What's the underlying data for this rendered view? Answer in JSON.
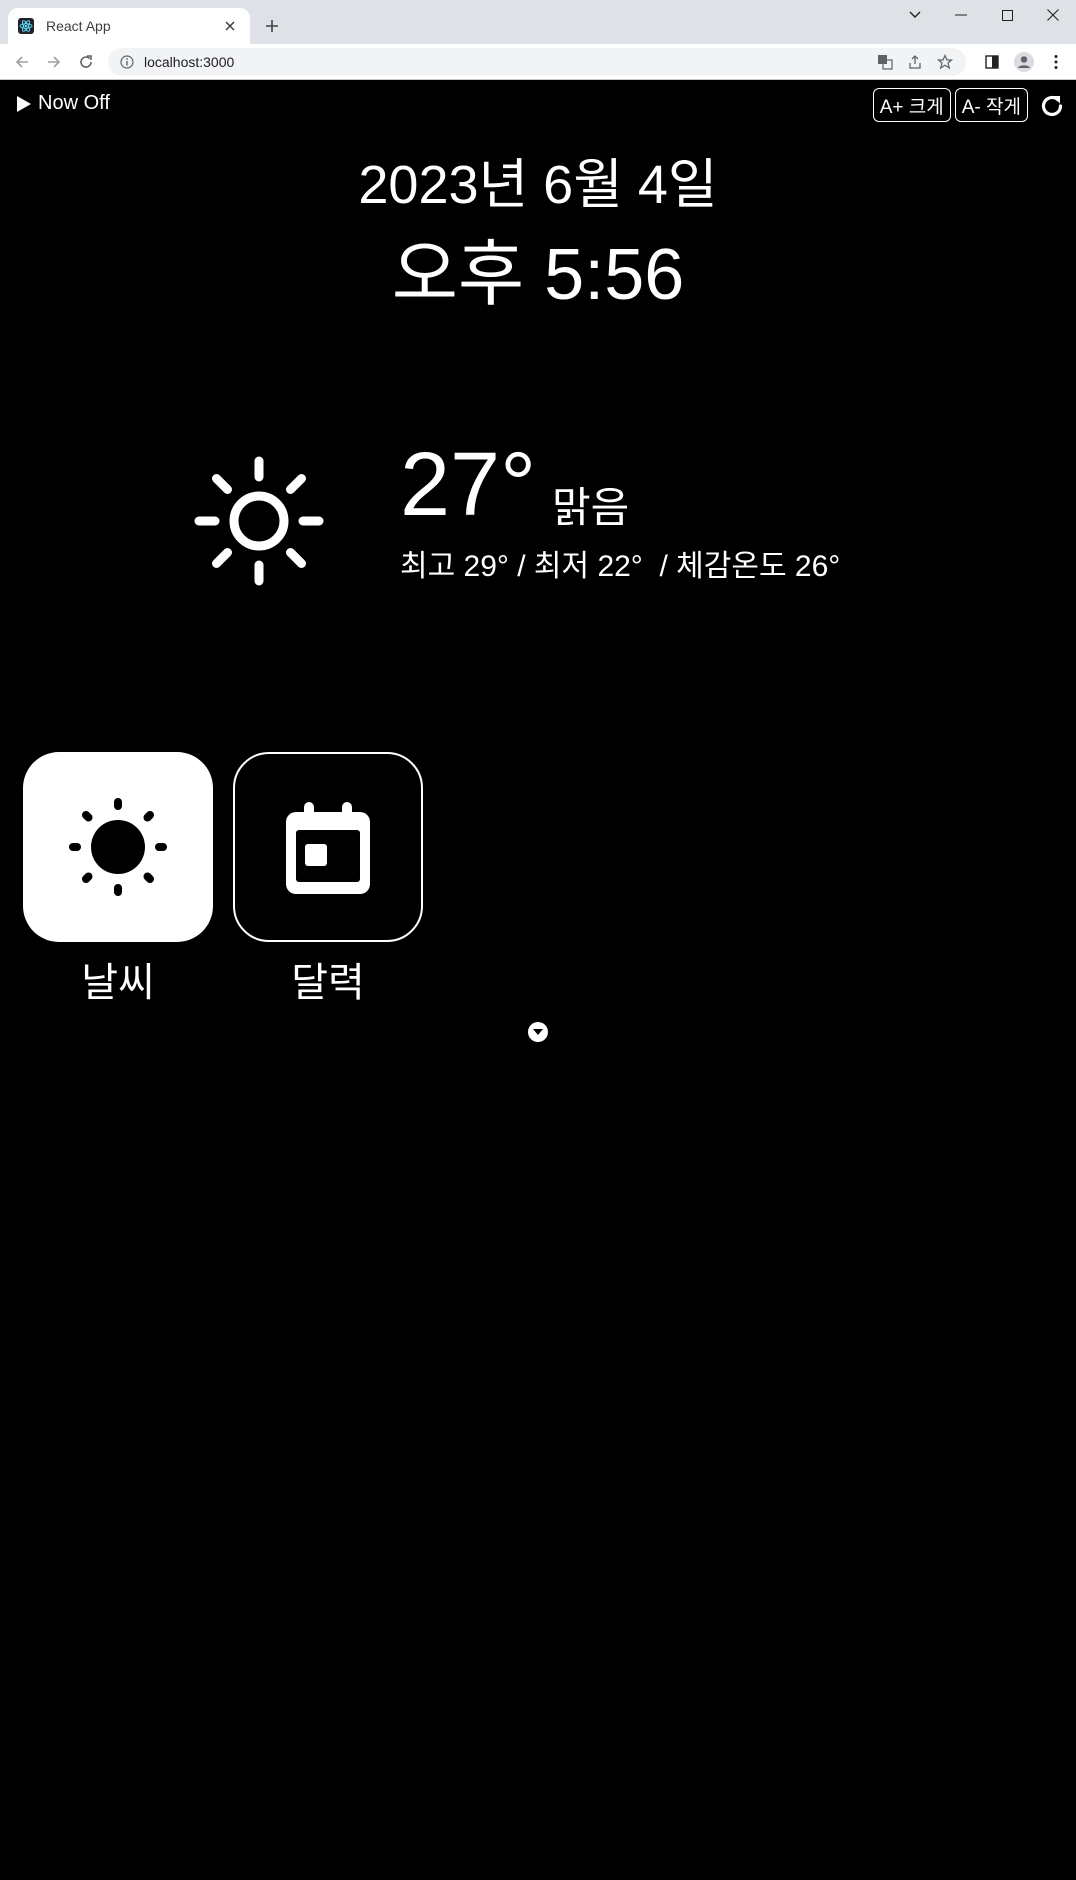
{
  "browser": {
    "tab_title": "React App",
    "url": "localhost:3000"
  },
  "header": {
    "now_toggle_label": "Now Off",
    "font_increase_label": "A+ 크게",
    "font_decrease_label": "A- 작게"
  },
  "clock": {
    "date": "2023년 6월 4일",
    "time": "오후 5:56"
  },
  "weather": {
    "icon": "sun-icon",
    "temperature": "27°",
    "condition": "맑음",
    "details": "최고 29° / 최저 22°  / 체감온도 26°"
  },
  "apps": [
    {
      "label": "날씨",
      "icon": "sun-icon"
    },
    {
      "label": "달력",
      "icon": "calendar-icon"
    }
  ],
  "colors": {
    "background": "#000000",
    "foreground": "#ffffff"
  }
}
